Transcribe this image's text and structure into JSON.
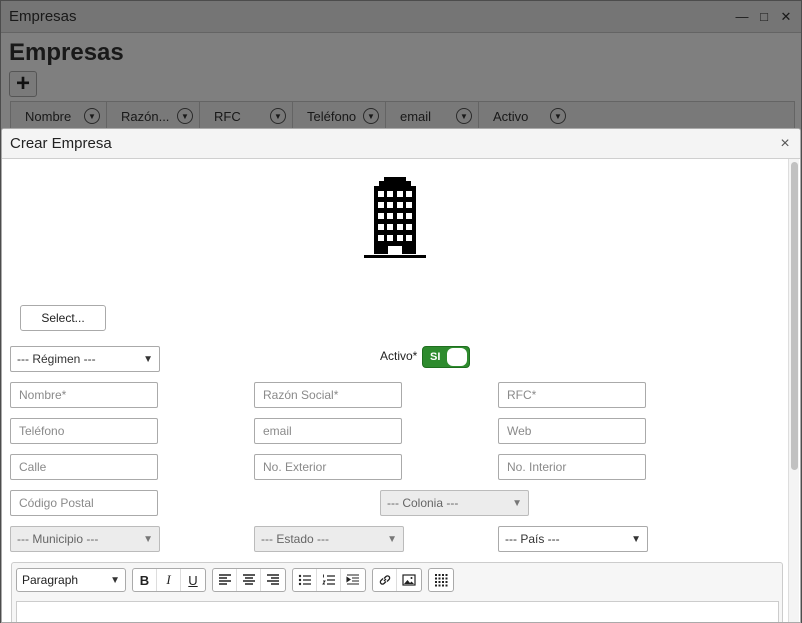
{
  "background": {
    "window_title": "Empresas",
    "heading": "Empresas",
    "add_label": "+",
    "columns": [
      "Nombre",
      "Razón...",
      "RFC",
      "Teléfono",
      "email",
      "Activo"
    ]
  },
  "dialog": {
    "title": "Crear Empresa",
    "close_label": "×",
    "select_button": "Select...",
    "regimen_label": "--- Régimen ---",
    "activo_label": "Activo*",
    "activo_toggle": "SI",
    "fields": {
      "nombre": "Nombre*",
      "razon_social": "Razón Social*",
      "rfc": "RFC*",
      "telefono": "Teléfono",
      "email": "email",
      "web": "Web",
      "calle": "Calle",
      "no_exterior": "No. Exterior",
      "no_interior": "No. Interior",
      "codigo_postal": "Código Postal"
    },
    "colonia_label": "--- Colonia ---",
    "municipio_label": "--- Municipio ---",
    "estado_label": "--- Estado ---",
    "pais_label": "--- País ---",
    "editor": {
      "block_format": "Paragraph",
      "bold": "B",
      "italic": "I",
      "underline": "U"
    }
  },
  "colors": {
    "toggle_on": "#2e8b2e",
    "overlay": "#000000"
  }
}
